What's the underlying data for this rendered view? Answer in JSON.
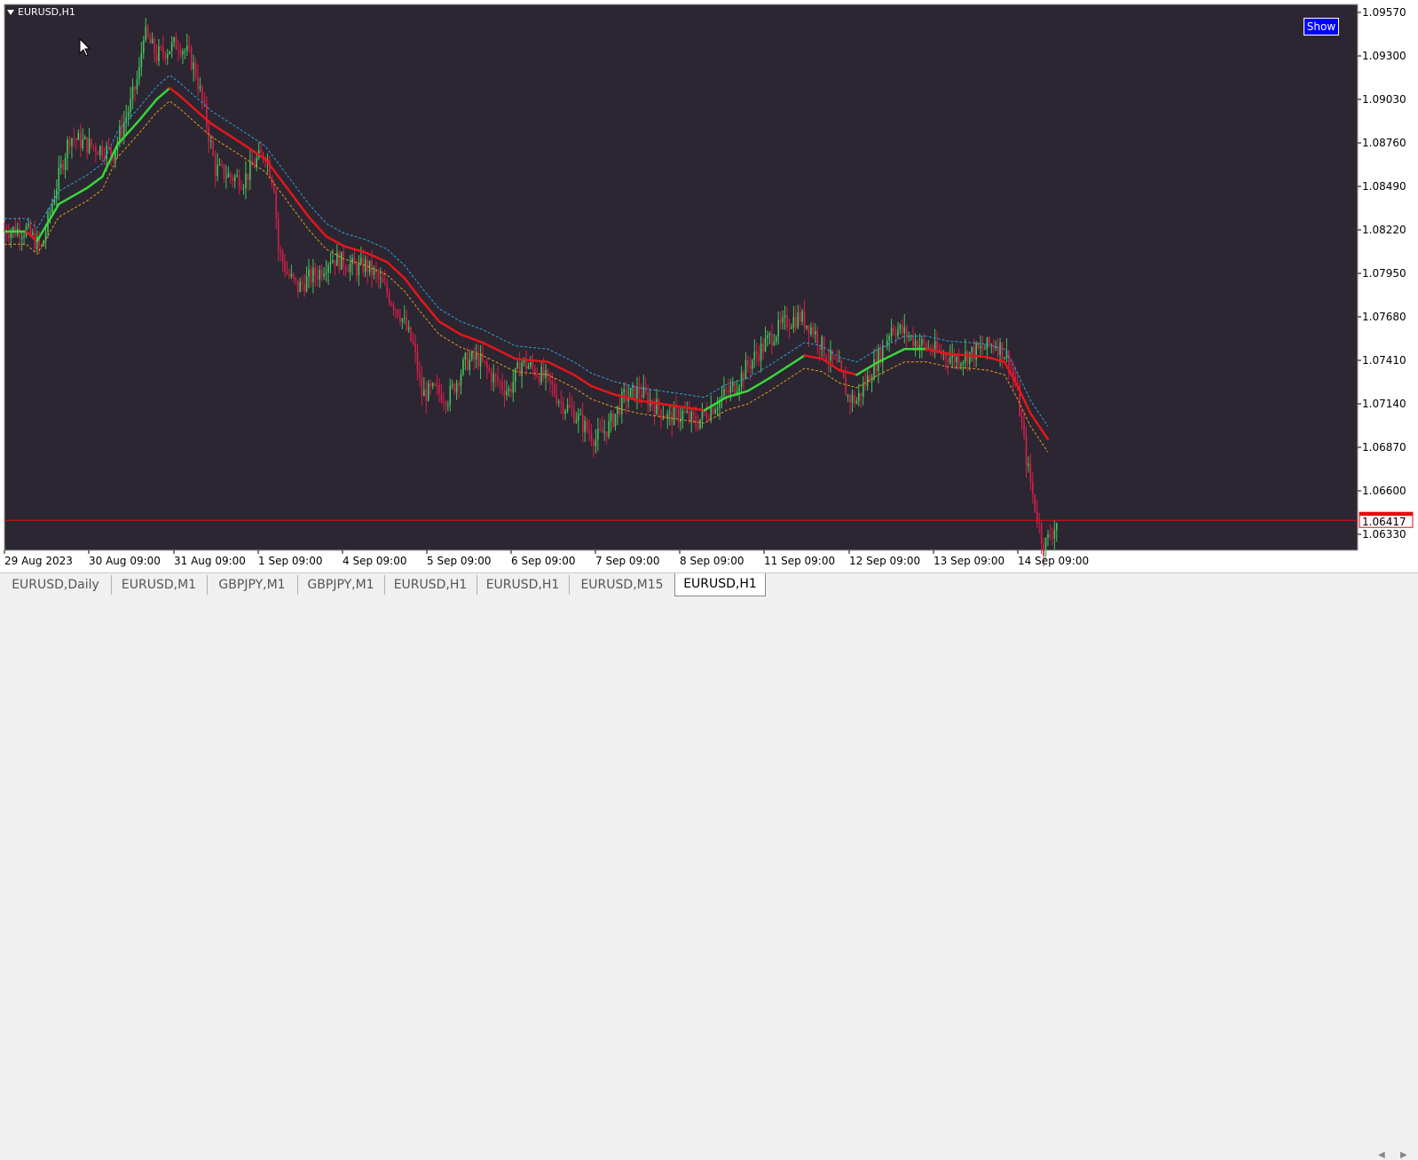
{
  "chart": {
    "symbol_label": "EURUSD,H1",
    "show_button": "Show",
    "current_price": "1.06417",
    "y_axis_labels": [
      "1.09570",
      "1.09300",
      "1.09030",
      "1.08760",
      "1.08490",
      "1.08220",
      "1.07950",
      "1.07680",
      "1.07410",
      "1.07140",
      "1.06870",
      "1.06600",
      "1.06330"
    ],
    "x_axis_labels": [
      "29 Aug 2023",
      "30 Aug 09:00",
      "31 Aug 09:00",
      "1 Sep 09:00",
      "4 Sep 09:00",
      "5 Sep 09:00",
      "6 Sep 09:00",
      "7 Sep 09:00",
      "8 Sep 09:00",
      "11 Sep 09:00",
      "12 Sep 09:00",
      "13 Sep 09:00",
      "14 Sep 09:00"
    ],
    "colors": {
      "background": "#2b2631",
      "bull_candle": "#45c55a",
      "bear_candle": "#d81e4a",
      "ma_up": "#39d63c",
      "ma_down": "#e5161a",
      "upper_band": "#2f9fe0",
      "lower_band": "#e89a20",
      "price_line": "#e01010"
    }
  },
  "chart_data": {
    "type": "line",
    "title": "EURUSD,H1",
    "xlabel": "",
    "ylabel": "",
    "ylim": [
      1.0622,
      1.0966
    ],
    "current_price": 1.06417,
    "close_series": [
      [
        0,
        1.0822
      ],
      [
        10,
        1.0822
      ],
      [
        17,
        1.081
      ],
      [
        24,
        1.085
      ],
      [
        30,
        1.088
      ],
      [
        38,
        1.0875
      ],
      [
        50,
        1.087
      ],
      [
        58,
        1.09
      ],
      [
        62,
        1.092
      ],
      [
        64,
        1.0945
      ],
      [
        70,
        1.093
      ],
      [
        76,
        1.0935
      ],
      [
        80,
        1.0938
      ],
      [
        85,
        1.093
      ],
      [
        88,
        1.092
      ],
      [
        92,
        1.0895
      ],
      [
        97,
        1.086
      ],
      [
        104,
        1.0855
      ],
      [
        110,
        1.0853
      ],
      [
        116,
        1.0865
      ],
      [
        120,
        1.087
      ],
      [
        124,
        1.085
      ],
      [
        126,
        1.081
      ],
      [
        130,
        1.0795
      ],
      [
        135,
        1.0786
      ],
      [
        140,
        1.0792
      ],
      [
        145,
        1.0796
      ],
      [
        150,
        1.0805
      ],
      [
        156,
        1.0802
      ],
      [
        162,
        1.0798
      ],
      [
        166,
        1.08
      ],
      [
        170,
        1.0795
      ],
      [
        176,
        1.0783
      ],
      [
        182,
        1.077
      ],
      [
        188,
        1.075
      ],
      [
        192,
        1.072
      ],
      [
        198,
        1.0722
      ],
      [
        204,
        1.0718
      ],
      [
        208,
        1.0728
      ],
      [
        212,
        1.074
      ],
      [
        218,
        1.0742
      ],
      [
        225,
        1.073
      ],
      [
        232,
        1.0722
      ],
      [
        238,
        1.074
      ],
      [
        244,
        1.0735
      ],
      [
        250,
        1.0728
      ],
      [
        256,
        1.0715
      ],
      [
        262,
        1.0708
      ],
      [
        268,
        1.0698
      ],
      [
        272,
        1.0692
      ],
      [
        278,
        1.07
      ],
      [
        285,
        1.0718
      ],
      [
        292,
        1.0722
      ],
      [
        300,
        1.0712
      ],
      [
        306,
        1.0705
      ],
      [
        312,
        1.0708
      ],
      [
        318,
        1.0702
      ],
      [
        324,
        1.071
      ],
      [
        330,
        1.0718
      ],
      [
        336,
        1.0725
      ],
      [
        342,
        1.0738
      ],
      [
        348,
        1.0748
      ],
      [
        354,
        1.0758
      ],
      [
        360,
        1.0765
      ],
      [
        366,
        1.0768
      ],
      [
        372,
        1.076
      ],
      [
        378,
        1.0745
      ],
      [
        384,
        1.0735
      ],
      [
        388,
        1.0718
      ],
      [
        392,
        1.0716
      ],
      [
        398,
        1.0732
      ],
      [
        404,
        1.0748
      ],
      [
        408,
        1.0762
      ],
      [
        414,
        1.0758
      ],
      [
        420,
        1.0752
      ],
      [
        426,
        1.0748
      ],
      [
        432,
        1.0745
      ],
      [
        438,
        1.0742
      ],
      [
        444,
        1.0745
      ],
      [
        450,
        1.0748
      ],
      [
        456,
        1.0752
      ],
      [
        462,
        1.0742
      ],
      [
        466,
        1.072
      ],
      [
        470,
        1.068
      ],
      [
        474,
        1.065
      ],
      [
        478,
        1.0625
      ],
      [
        484,
        1.064
      ]
    ],
    "ma_series": [
      [
        0,
        1.0821
      ],
      [
        10,
        1.0821
      ],
      [
        15,
        1.0815
      ],
      [
        25,
        1.0838
      ],
      [
        38,
        1.0848
      ],
      [
        45,
        1.0855
      ],
      [
        52,
        1.0875
      ],
      [
        62,
        1.089
      ],
      [
        70,
        1.0903
      ],
      [
        76,
        1.091
      ],
      [
        80,
        1.0906
      ],
      [
        95,
        1.0888
      ],
      [
        110,
        1.0875
      ],
      [
        120,
        1.0866
      ],
      [
        130,
        1.0848
      ],
      [
        140,
        1.083
      ],
      [
        148,
        1.0818
      ],
      [
        156,
        1.0812
      ],
      [
        166,
        1.0808
      ],
      [
        176,
        1.0802
      ],
      [
        184,
        1.0792
      ],
      [
        192,
        1.0778
      ],
      [
        200,
        1.0765
      ],
      [
        210,
        1.0757
      ],
      [
        220,
        1.0752
      ],
      [
        235,
        1.0742
      ],
      [
        250,
        1.074
      ],
      [
        262,
        1.0732
      ],
      [
        270,
        1.0725
      ],
      [
        280,
        1.072
      ],
      [
        292,
        1.0716
      ],
      [
        302,
        1.0714
      ],
      [
        312,
        1.0712
      ],
      [
        322,
        1.071
      ],
      [
        332,
        1.0718
      ],
      [
        342,
        1.0722
      ],
      [
        352,
        1.073
      ],
      [
        360,
        1.0737
      ],
      [
        368,
        1.0744
      ],
      [
        376,
        1.0742
      ],
      [
        384,
        1.0735
      ],
      [
        392,
        1.0732
      ],
      [
        402,
        1.074
      ],
      [
        414,
        1.0748
      ],
      [
        424,
        1.0748
      ],
      [
        434,
        1.0745
      ],
      [
        444,
        1.0744
      ],
      [
        452,
        1.0743
      ],
      [
        460,
        1.074
      ],
      [
        466,
        1.0725
      ],
      [
        472,
        1.0708
      ],
      [
        480,
        1.0692
      ]
    ],
    "band_offset": 0.0008
  }
}
